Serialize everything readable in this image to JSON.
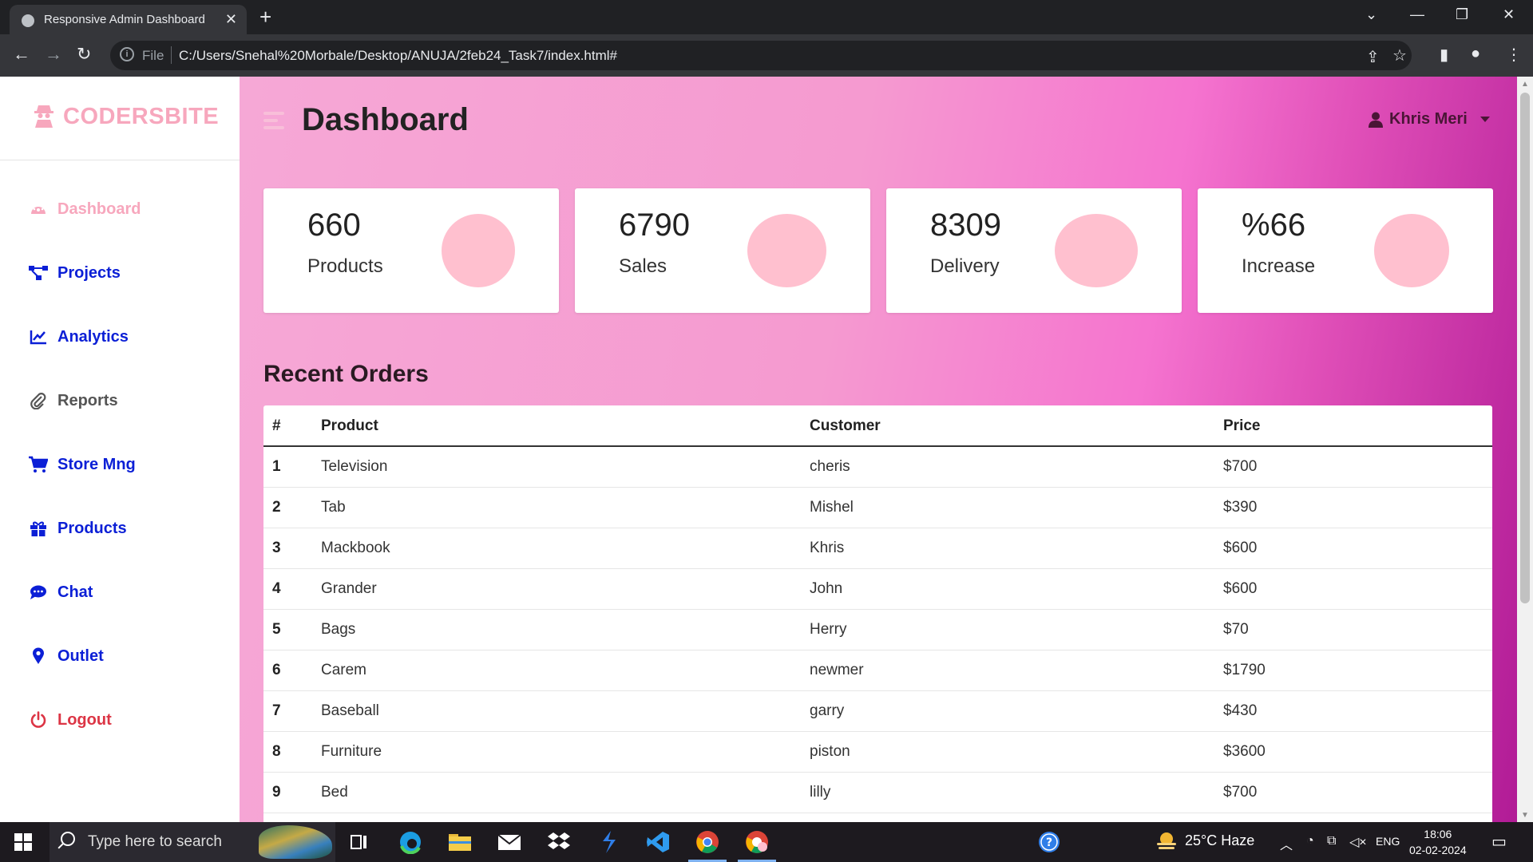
{
  "browser": {
    "tab_title": "Responsive Admin Dashboard",
    "url_scheme": "File",
    "url": "C:/Users/Snehal%20Morbale/Desktop/ANUJA/2feb24_Task7/index.html#"
  },
  "brand": {
    "name": "CODERSBITE"
  },
  "sidebar": {
    "items": [
      {
        "label": "Dashboard",
        "icon": "palette-icon",
        "color": "#f7a7bd"
      },
      {
        "label": "Projects",
        "icon": "project-diagram-icon",
        "color": "#0b1fd6"
      },
      {
        "label": "Analytics",
        "icon": "line-chart-icon",
        "color": "#0b1fd6"
      },
      {
        "label": "Reports",
        "icon": "paperclip-icon",
        "color": "#555555"
      },
      {
        "label": "Store Mng",
        "icon": "cart-icon",
        "color": "#0b1fd6"
      },
      {
        "label": "Products",
        "icon": "gift-icon",
        "color": "#0b1fd6"
      },
      {
        "label": "Chat",
        "icon": "chat-icon",
        "color": "#0b1fd6"
      },
      {
        "label": "Outlet",
        "icon": "map-pin-icon",
        "color": "#0b1fd6"
      },
      {
        "label": "Logout",
        "icon": "power-icon",
        "color": "#dc3545"
      }
    ]
  },
  "header": {
    "title": "Dashboard",
    "user_name": "Khris Meri"
  },
  "cards": [
    {
      "value": "660",
      "label": "Products"
    },
    {
      "value": "6790",
      "label": "Sales"
    },
    {
      "value": "8309",
      "label": "Delivery"
    },
    {
      "value": "%66",
      "label": "Increase"
    }
  ],
  "orders": {
    "title": "Recent Orders",
    "columns": [
      "#",
      "Product",
      "Customer",
      "Price"
    ],
    "rows": [
      [
        "1",
        "Television",
        "cheris",
        "$700"
      ],
      [
        "2",
        "Tab",
        "Mishel",
        "$390"
      ],
      [
        "3",
        "Mackbook",
        "Khris",
        "$600"
      ],
      [
        "4",
        "Grander",
        "John",
        "$600"
      ],
      [
        "5",
        "Bags",
        "Herry",
        "$70"
      ],
      [
        "6",
        "Carem",
        "newmer",
        "$1790"
      ],
      [
        "7",
        "Baseball",
        "garry",
        "$430"
      ],
      [
        "8",
        "Furniture",
        "piston",
        "$3600"
      ],
      [
        "9",
        "Bed",
        "lilly",
        "$700"
      ]
    ]
  },
  "taskbar": {
    "search_placeholder": "Type here to search",
    "weather": "25°C  Haze",
    "language": "ENG",
    "time": "18:06",
    "date": "02-02-2024"
  },
  "colors": {
    "brand": "#f7a7bd",
    "nav_link": "#0b1fd6",
    "logout": "#dc3545",
    "card_circle": "#ffc0cf"
  }
}
